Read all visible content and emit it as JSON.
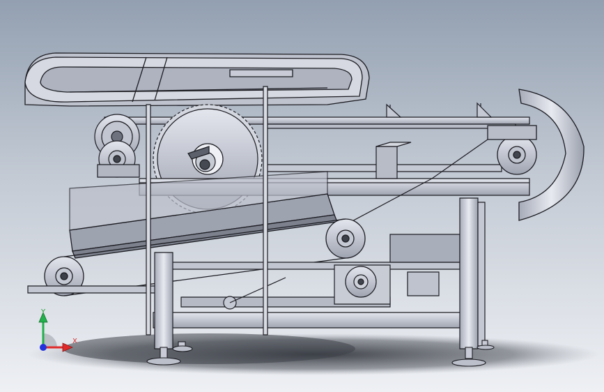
{
  "triad": {
    "x_label": "X",
    "y_label": "Y",
    "x_color": "#e02a2a",
    "y_color": "#22b14c",
    "z_color": "#2233dd"
  },
  "colors": {
    "steel": "#c9ccd6",
    "steel_dark": "#8a8f9c",
    "outline": "#1c1c22",
    "shadow": "#3a3d44"
  }
}
